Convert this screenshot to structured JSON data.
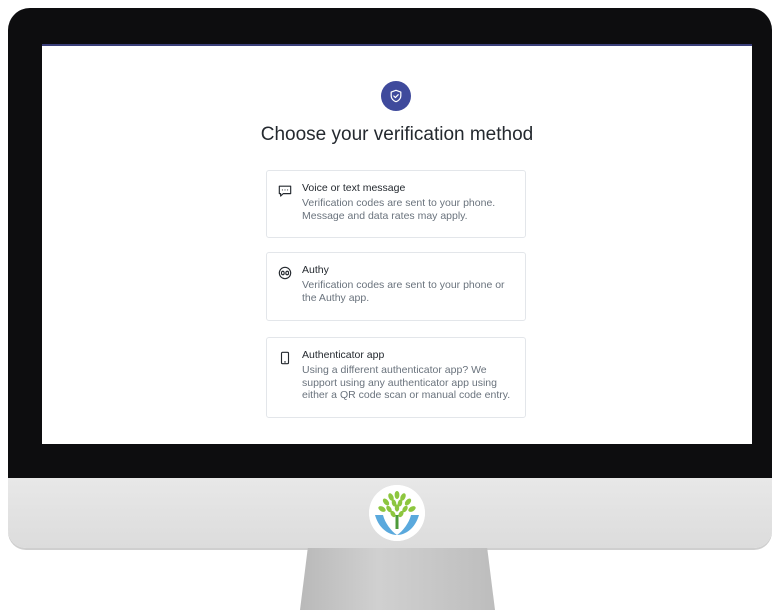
{
  "page": {
    "title": "Choose your verification method"
  },
  "methods": [
    {
      "title": "Voice or text message",
      "description": "Verification codes are sent to your phone. Message and data rates may apply.",
      "icon": "message-icon"
    },
    {
      "title": "Authy",
      "description": "Verification codes are sent to your phone or the Authy app.",
      "icon": "authy-icon"
    },
    {
      "title": "Authenticator app",
      "description": "Using a different authenticator app? We support using any authenticator app using either a QR code scan or manual code entry.",
      "icon": "phone-icon"
    }
  ],
  "colors": {
    "accent": "#3f4a9c",
    "bezel": "#0d0d0f",
    "chin": "#e0e0e0",
    "title_text": "#24292f",
    "muted_text": "#6a737d",
    "card_border": "#e3e6ea",
    "logo_leaves": "#8dc63f",
    "logo_hands": "#5aa9dd"
  },
  "icons": {
    "header": "shield-check-icon",
    "brand": "tree-logo-icon"
  }
}
